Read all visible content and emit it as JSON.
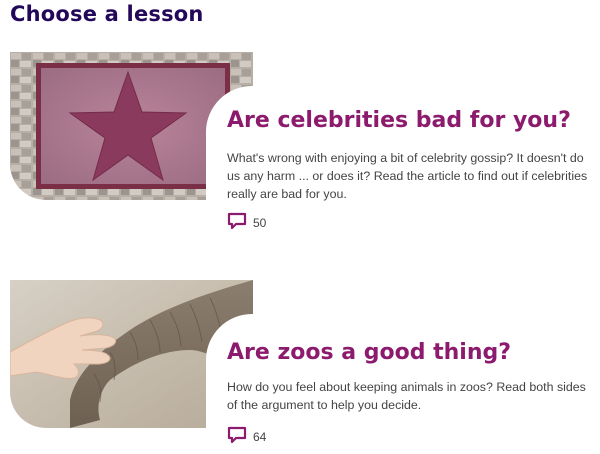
{
  "page": {
    "heading": "Choose a lesson"
  },
  "lessons": [
    {
      "title": "Are celebrities bad for you?",
      "description": "What's wrong with enjoying a bit of celebrity gossip? It doesn't do us any harm ... or does it? Read the article to find out if celebrities really are bad for you.",
      "comment_count": "50",
      "image": "walk-of-fame-star"
    },
    {
      "title": "Are zoos a good thing?",
      "description": "How do you feel about keeping animals in zoos? Read both sides of the argument to help you decide.",
      "comment_count": "64",
      "image": "hand-touching-elephant-trunk"
    }
  ],
  "colors": {
    "heading": "#23085a",
    "title_accent": "#8c1b6e",
    "body_text": "#444444"
  },
  "icons": {
    "comments": "speech-bubble-icon"
  }
}
